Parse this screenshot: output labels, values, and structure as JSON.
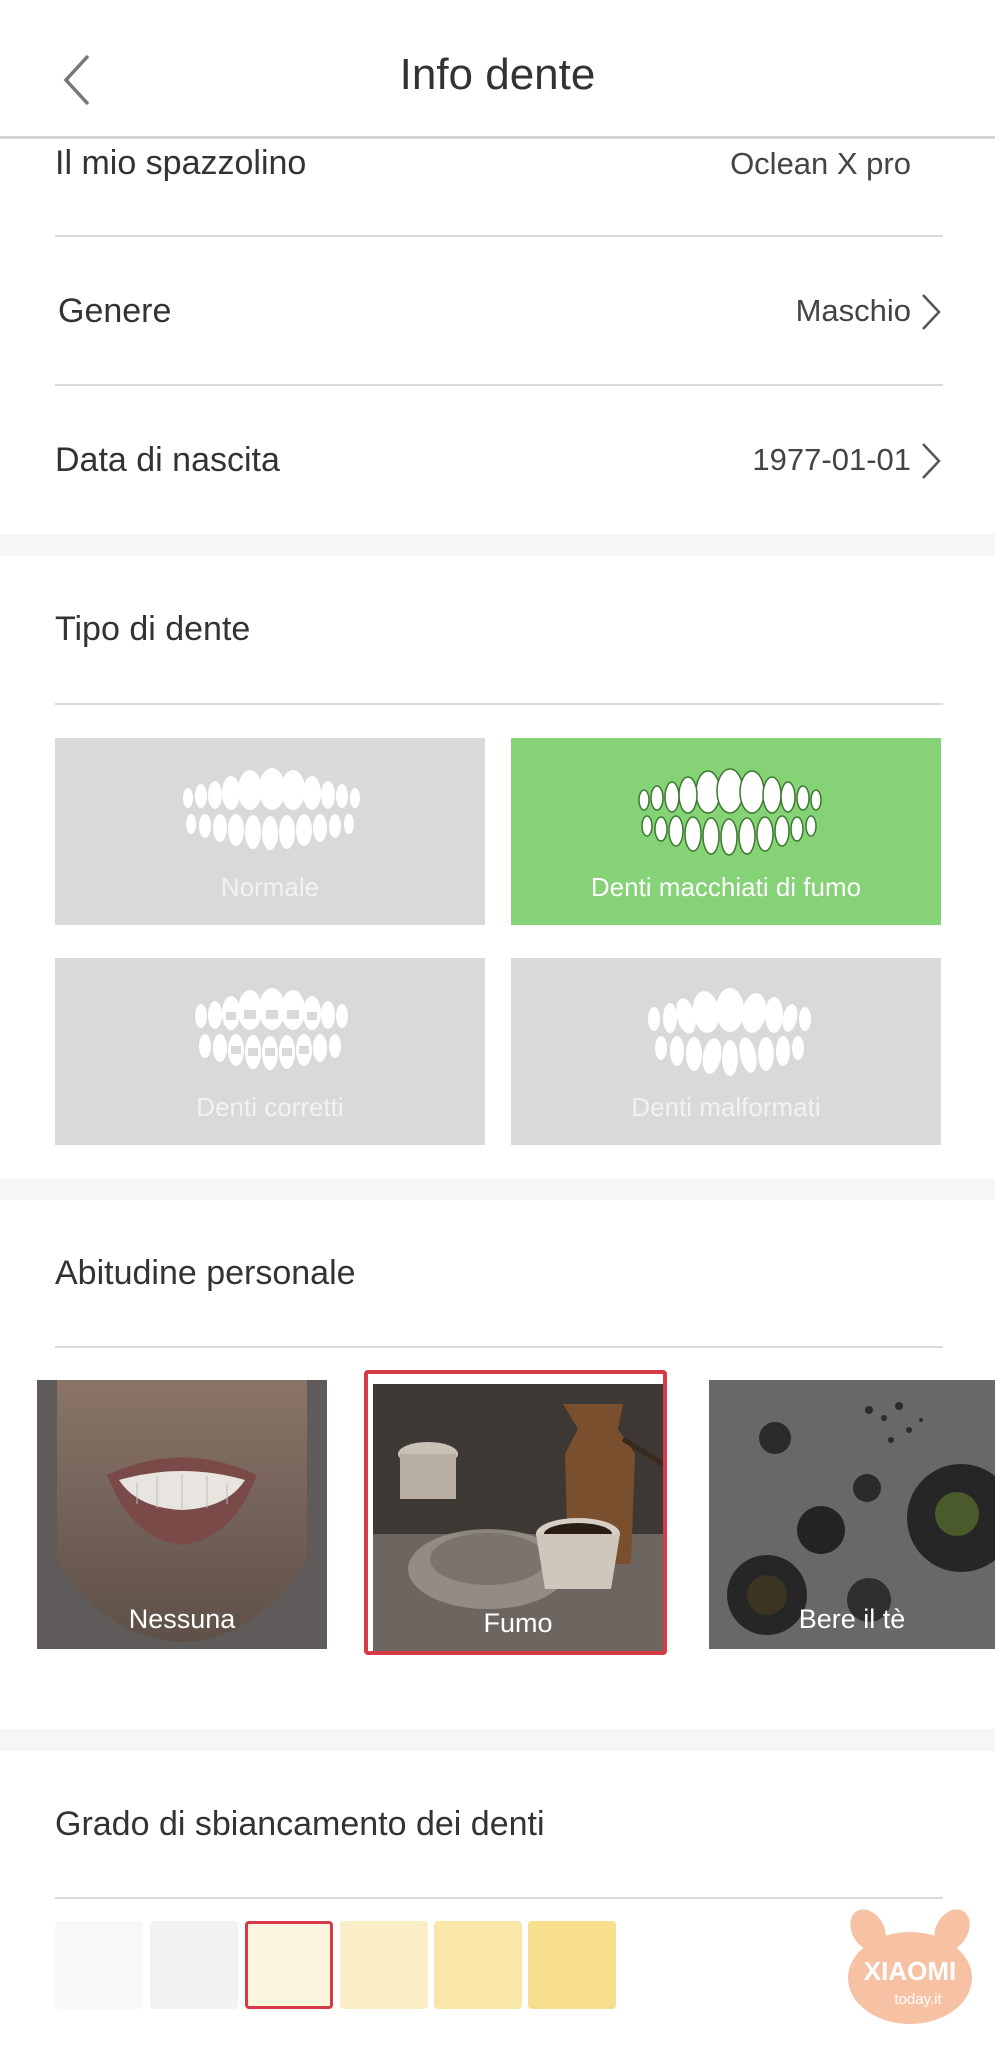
{
  "header": {
    "title": "Info dente"
  },
  "profile": {
    "toothbrush": {
      "label": "Il mio spazzolino",
      "value": "Oclean X pro"
    },
    "gender": {
      "label": "Genere",
      "value": "Maschio"
    },
    "birthdate": {
      "label": "Data di nascita",
      "value": "1977-01-01"
    }
  },
  "tooth_type": {
    "title": "Tipo di dente",
    "options": [
      {
        "label": "Normale",
        "selected": false
      },
      {
        "label": "Denti macchiati di fumo",
        "selected": true
      },
      {
        "label": "Denti corretti",
        "selected": false
      },
      {
        "label": "Denti malformati",
        "selected": false
      }
    ]
  },
  "habits": {
    "title": "Abitudine personale",
    "options": [
      {
        "label": "Nessuna",
        "selected": false
      },
      {
        "label": "Fumo",
        "selected": true
      },
      {
        "label": "Bere il tè",
        "selected": false
      }
    ]
  },
  "whitening": {
    "title": "Grado di sbiancamento dei denti",
    "swatch_colors": [
      "#f8f8f8",
      "#f2f2f2",
      "#fbf4df",
      "#f9eec6",
      "#f8e7a8",
      "#f7df8e"
    ],
    "selected_index": 2
  },
  "watermark": {
    "brand": "XIAOMI",
    "site": "today.it"
  },
  "colors": {
    "accent_green": "#86d277",
    "selection_red": "#d53a46"
  }
}
